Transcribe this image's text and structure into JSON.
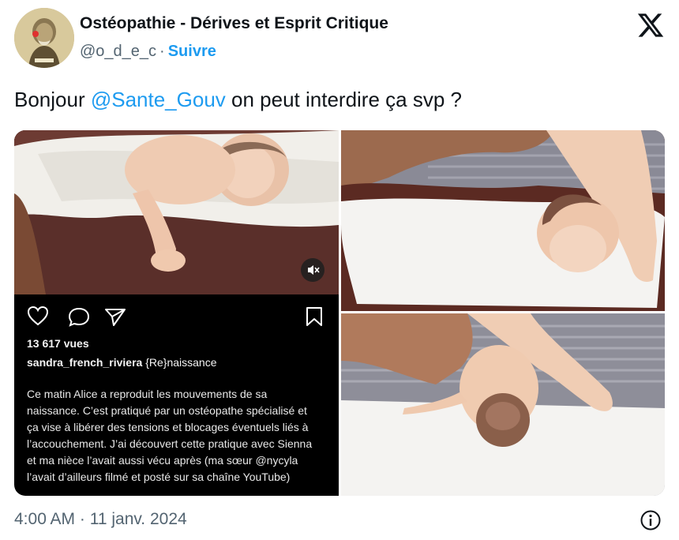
{
  "author": {
    "name": "Ostéopathie - Dérives et Esprit Critique",
    "handle": "@o_d_e_c",
    "separator": "·",
    "follow_label": "Suivre"
  },
  "tweet": {
    "text_before": "Bonjour ",
    "mention": "@Sante_Gouv",
    "text_after": " on peut interdire ça svp ?"
  },
  "instagram": {
    "views": "13 617 vues",
    "username": "sandra_french_riviera",
    "title": "{Re}naissance",
    "caption": "Ce matin Alice a reproduit les mouvements de sa naissance. C’est pratiqué par un ostéopathe spécialisé et ça vise à libérer des tensions et blocages éventuels liés à l’accouchement. J’ai découvert cette pratique avec Sienna et ma nièce l’avait aussi vécu après (ma sœur @nycyla l’avait d’ailleurs filmé et posté sur sa chaîne YouTube)"
  },
  "footer": {
    "timestamp": "4:00 AM · 11 janv. 2024"
  },
  "icons": {
    "x_logo": "x-logo-icon",
    "info": "info-icon",
    "heart": "heart-icon",
    "comment": "comment-icon",
    "share": "share-icon",
    "bookmark": "bookmark-icon",
    "mute": "mute-icon"
  },
  "colors": {
    "link": "#1d9bf0",
    "secondary_text": "#536471",
    "text": "#0f1419"
  }
}
